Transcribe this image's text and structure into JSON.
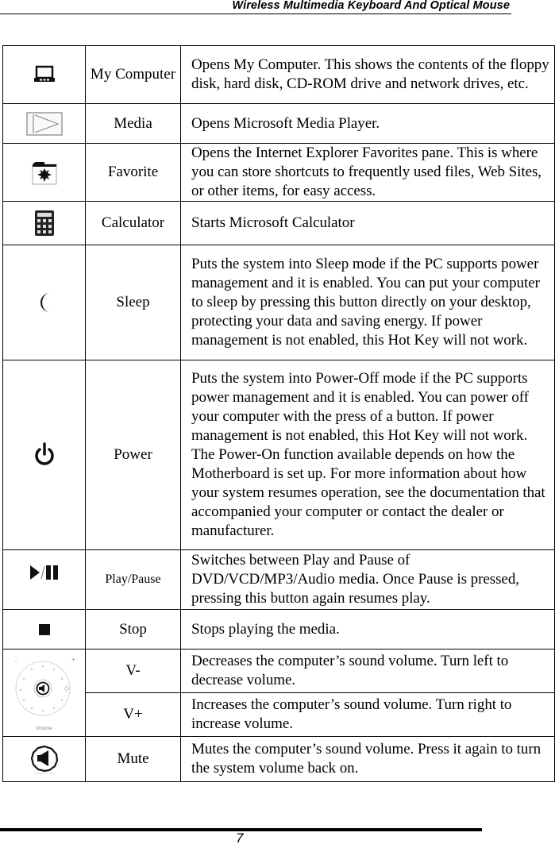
{
  "header": {
    "title": "Wireless Multimedia Keyboard And Optical Mouse"
  },
  "rows": [
    {
      "icon": "my-computer-icon",
      "name": "My Computer",
      "description": "Opens My Computer. This shows the contents of the floppy disk, hard disk, CD-ROM drive and network drives, etc."
    },
    {
      "icon": "media-icon",
      "name": "Media",
      "description": "Opens Microsoft Media Player."
    },
    {
      "icon": "favorite-icon",
      "name": "Favorite",
      "description": "Opens the Internet Explorer Favorites pane. This is where you can store shortcuts to frequently used files, Web Sites, or other items, for easy access."
    },
    {
      "icon": "calculator-icon",
      "name": "Calculator",
      "description": "Starts Microsoft Calculator"
    },
    {
      "icon": "sleep-moon-icon",
      "name": "Sleep",
      "description": "Puts the system into Sleep mode if the PC supports power management and it is enabled. You can put your computer to sleep by pressing this button directly on your desktop, protecting your data and saving energy. If power management is not enabled, this Hot Key will not work."
    },
    {
      "icon": "power-icon",
      "name": "Power",
      "description": "Puts the system into Power-Off mode if the PC supports power management and it is enabled. You can power off your computer with the press of a button. If power management is not enabled, this Hot Key will not work. The Power-On function available depends on how the Motherboard is set up. For more information about how your system resumes operation, see the documentation that accompanied your computer or contact the dealer or manufacturer."
    },
    {
      "icon": "play-pause-icon",
      "name": "Play/Pause",
      "description": "Switches between Play and Pause of DVD/VCD/MP3/Audio media. Once Pause is pressed, pressing this button again resumes play."
    },
    {
      "icon": "stop-icon",
      "name": "Stop",
      "description": "Stops playing the media."
    },
    {
      "icon": "volume-dial-icon",
      "icon_caption": "Volume",
      "name": "V-",
      "description": "Decreases the computer’s sound volume. Turn left to decrease volume."
    },
    {
      "name": "V+",
      "description": "Increases the computer’s sound volume. Turn right to increase volume."
    },
    {
      "icon": "mute-icon",
      "name": "Mute",
      "description": "Mutes the computer’s sound volume. Press it again to turn the system volume back on."
    }
  ],
  "footer": {
    "page_number": "7"
  }
}
